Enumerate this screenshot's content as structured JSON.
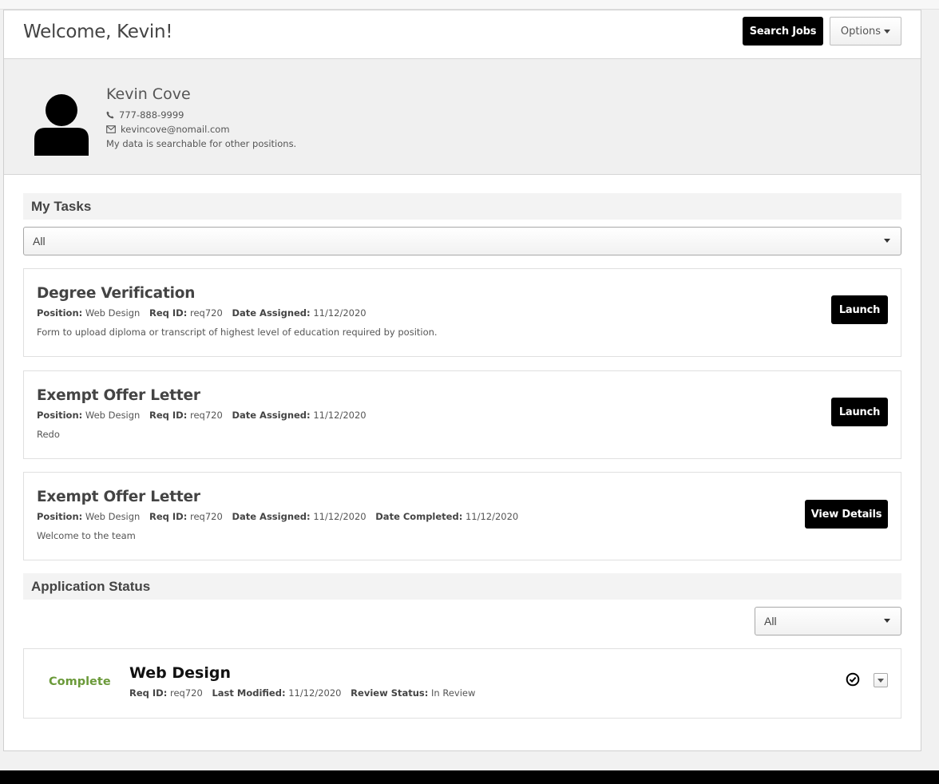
{
  "header": {
    "welcome": "Welcome, Kevin!",
    "search_jobs_label": "Search Jobs",
    "options_label": "Options"
  },
  "profile": {
    "name": "Kevin Cove",
    "phone": "777-888-9999",
    "email": "kevincove@nomail.com",
    "searchable_note": "My data is searchable for other positions."
  },
  "tasks": {
    "heading": "My Tasks",
    "filter_value": "All",
    "labels": {
      "position": "Position:",
      "req_id": "Req ID:",
      "date_assigned": "Date Assigned:",
      "date_completed": "Date Completed:"
    },
    "items": [
      {
        "title": "Degree Verification",
        "position": "Web Design",
        "req_id": "req720",
        "date_assigned": "11/12/2020",
        "description": "Form to upload diploma or transcript of highest level of education required by position.",
        "action": "Launch"
      },
      {
        "title": "Exempt Offer Letter",
        "position": "Web Design",
        "req_id": "req720",
        "date_assigned": "11/12/2020",
        "description": "Redo",
        "action": "Launch"
      },
      {
        "title": "Exempt Offer Letter",
        "position": "Web Design",
        "req_id": "req720",
        "date_assigned": "11/12/2020",
        "date_completed": "11/12/2020",
        "description": "Welcome to the team",
        "action": "View Details"
      }
    ]
  },
  "application_status": {
    "heading": "Application Status",
    "filter_value": "All",
    "labels": {
      "req_id": "Req ID:",
      "last_modified": "Last Modified:",
      "review_status": "Review Status:"
    },
    "items": [
      {
        "status": "Complete",
        "status_color": "#6b9a3a",
        "title": "Web Design",
        "req_id": "req720",
        "last_modified": "11/12/2020",
        "review_status": "In Review"
      }
    ]
  }
}
